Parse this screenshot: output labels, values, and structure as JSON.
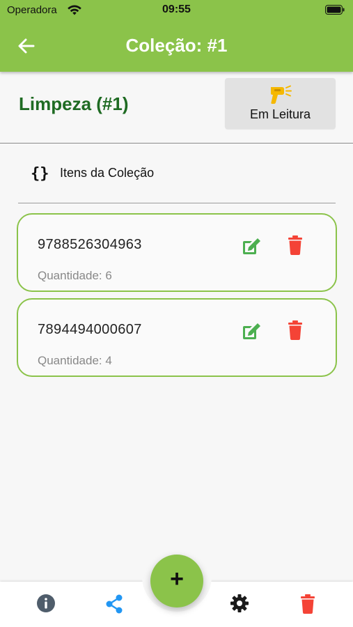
{
  "status_bar": {
    "carrier": "Operadora",
    "time": "09:55"
  },
  "header": {
    "title": "Coleção: #1",
    "back_icon": "arrow-left-icon"
  },
  "collection": {
    "name": "Limpeza (#1)",
    "reading_button_label": "Em Leitura",
    "reading_button_icon": "barcode-scanner-icon"
  },
  "section": {
    "icon": "braces-icon",
    "title": "Itens da Coleção"
  },
  "items": [
    {
      "code": "9788526304963",
      "quantity_text": "Quantidade: 6"
    },
    {
      "code": "7894494000607",
      "quantity_text": "Quantidade: 4"
    }
  ],
  "bottom_nav": {
    "items": [
      {
        "icon": "info-icon"
      },
      {
        "icon": "share-icon"
      },
      {
        "icon": "add-icon",
        "label": "+"
      },
      {
        "icon": "gear-icon"
      },
      {
        "icon": "trash-icon"
      }
    ]
  },
  "colors": {
    "primary": "#8bc34a",
    "title_green": "#1f6b23",
    "edit_green": "#4caf50",
    "delete_red": "#f44336",
    "share_blue": "#2196f3",
    "scanner_yellow": "#f5b800"
  }
}
